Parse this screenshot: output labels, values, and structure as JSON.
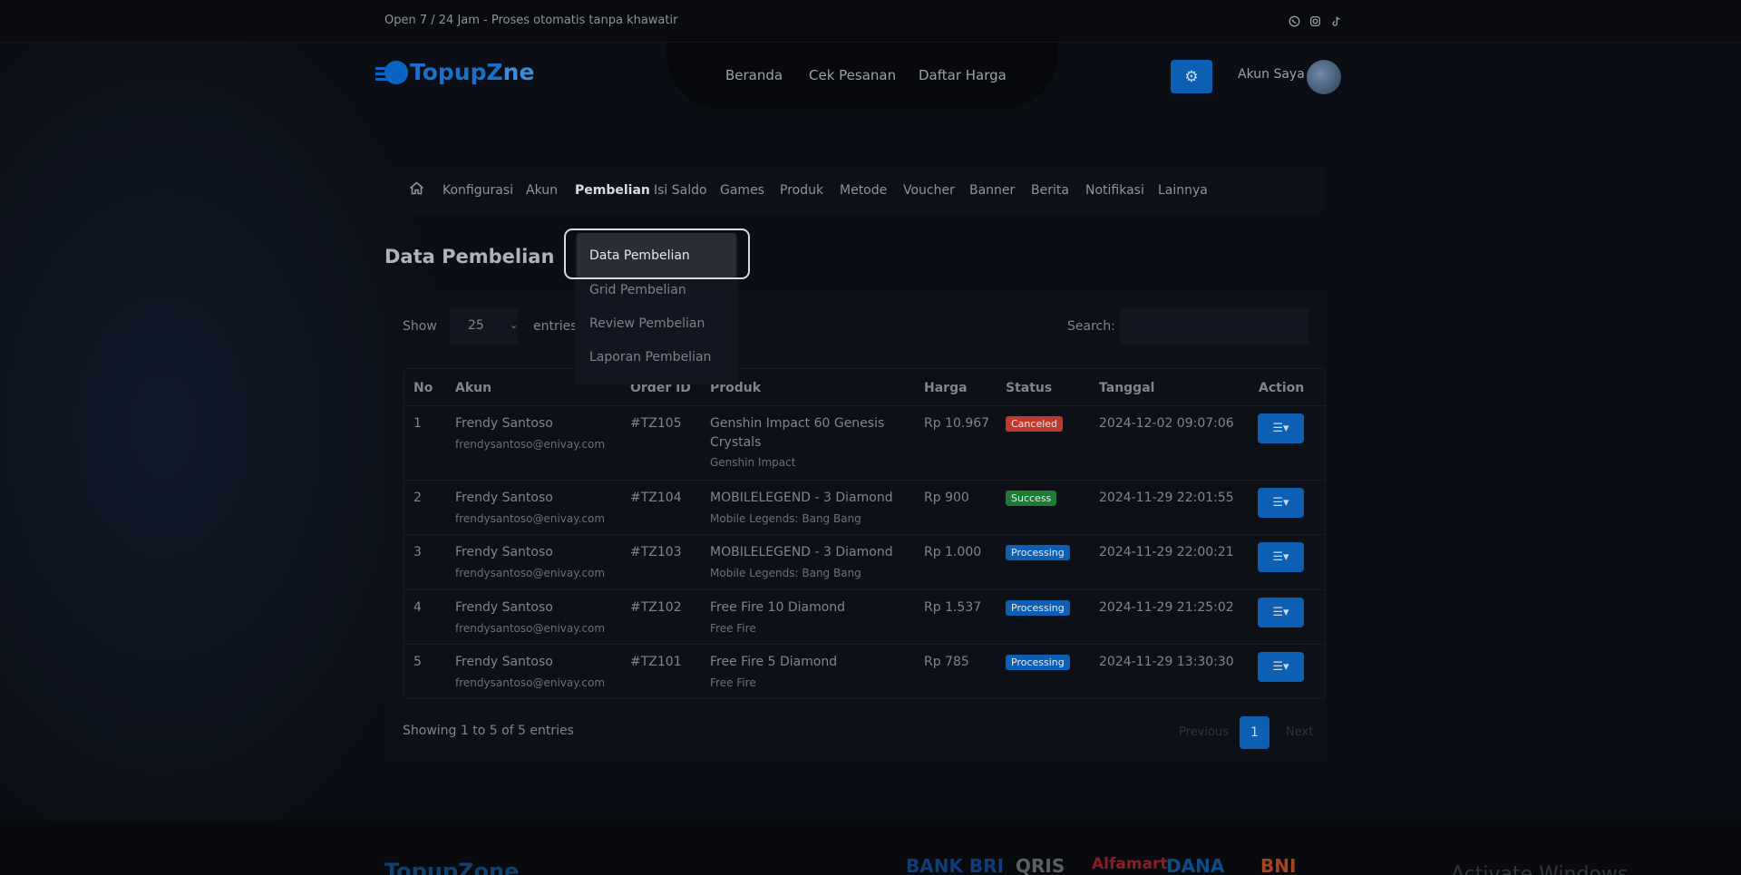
{
  "topbar": {
    "text": "Open 7 / 24 Jam - Proses otomatis tanpa khawatir"
  },
  "brand": {
    "part1": "Topup",
    "part2": "Z",
    "part3": "ne"
  },
  "nav": {
    "items": [
      "Beranda",
      "Cek Pesanan",
      "Daftar Harga"
    ]
  },
  "header": {
    "account_label": "Akun Saya"
  },
  "menu": {
    "items": [
      "Konfigurasi",
      "Akun",
      "Pembelian",
      "Isi Saldo",
      "Games",
      "Produk",
      "Metode",
      "Voucher",
      "Banner",
      "Berita",
      "Notifikasi",
      "Lainnya"
    ],
    "active": "Pembelian"
  },
  "dropdown": {
    "items": [
      "Data Pembelian",
      "Grid Pembelian",
      "Review Pembelian",
      "Laporan Pembelian"
    ]
  },
  "page": {
    "title": "Data Pembelian"
  },
  "table_controls": {
    "show_label": "Show",
    "entries_value": "25",
    "entries_label": "entries",
    "search_label": "Search:",
    "search_value": ""
  },
  "table": {
    "headers": [
      "No",
      "Akun",
      "Order ID",
      "Produk",
      "Harga",
      "Status",
      "Tanggal",
      "Action"
    ],
    "rows": [
      {
        "no": "1",
        "name": "Frendy Santoso",
        "email": "frendysantoso@enivay.com",
        "order_id": "#TZ105",
        "product_line1": "Genshin Impact 60 Genesis",
        "product_line2": "Crystals",
        "game": "Genshin Impact",
        "price": "Rp 10.967",
        "status": "Canceled",
        "status_color": "#c0392b",
        "date": "2024-12-02 09:07:06"
      },
      {
        "no": "2",
        "name": "Frendy Santoso",
        "email": "frendysantoso@enivay.com",
        "order_id": "#TZ104",
        "product_line1": "MOBILELEGEND - 3 Diamond",
        "product_line2": "",
        "game": "Mobile Legends: Bang Bang",
        "price": "Rp 900",
        "status": "Success",
        "status_color": "#1e7b34",
        "date": "2024-11-29 22:01:55"
      },
      {
        "no": "3",
        "name": "Frendy Santoso",
        "email": "frendysantoso@enivay.com",
        "order_id": "#TZ103",
        "product_line1": "MOBILELEGEND - 3 Diamond",
        "product_line2": "",
        "game": "Mobile Legends: Bang Bang",
        "price": "Rp 1.000",
        "status": "Processing",
        "status_color": "#0d5fb3",
        "date": "2024-11-29 22:00:21"
      },
      {
        "no": "4",
        "name": "Frendy Santoso",
        "email": "frendysantoso@enivay.com",
        "order_id": "#TZ102",
        "product_line1": "Free Fire 10 Diamond",
        "product_line2": "",
        "game": "Free Fire",
        "price": "Rp 1.537",
        "status": "Processing",
        "status_color": "#0d5fb3",
        "date": "2024-11-29 21:25:02"
      },
      {
        "no": "5",
        "name": "Frendy Santoso",
        "email": "frendysantoso@enivay.com",
        "order_id": "#TZ101",
        "product_line1": "Free Fire 5 Diamond",
        "product_line2": "",
        "game": "Free Fire",
        "price": "Rp 785",
        "status": "Processing",
        "status_color": "#0d5fb3",
        "date": "2024-11-29 13:30:30"
      }
    ]
  },
  "pagination": {
    "info": "Showing 1 to 5 of 5 entries",
    "previous": "Previous",
    "current": "1",
    "next": "Next"
  },
  "footer": {
    "logo_text": "TopupZone",
    "payments": [
      "BANK BRI",
      "QRIS",
      "Alfamart",
      "DANA",
      "BNI"
    ],
    "payment_colors": [
      "#0d3d7a",
      "#5a5f66",
      "#8a1e24",
      "#0d4c8a",
      "#a8431e"
    ],
    "watermark": "Activate Windows"
  },
  "icons": {
    "social": [
      "whatsapp-icon",
      "instagram-icon",
      "tiktok-icon"
    ],
    "settings": "gear-icon",
    "home": "home-icon",
    "action": "menu-caret-icon"
  },
  "colors": {
    "accent": "#0d5fb3",
    "background": "#0b0e14"
  }
}
